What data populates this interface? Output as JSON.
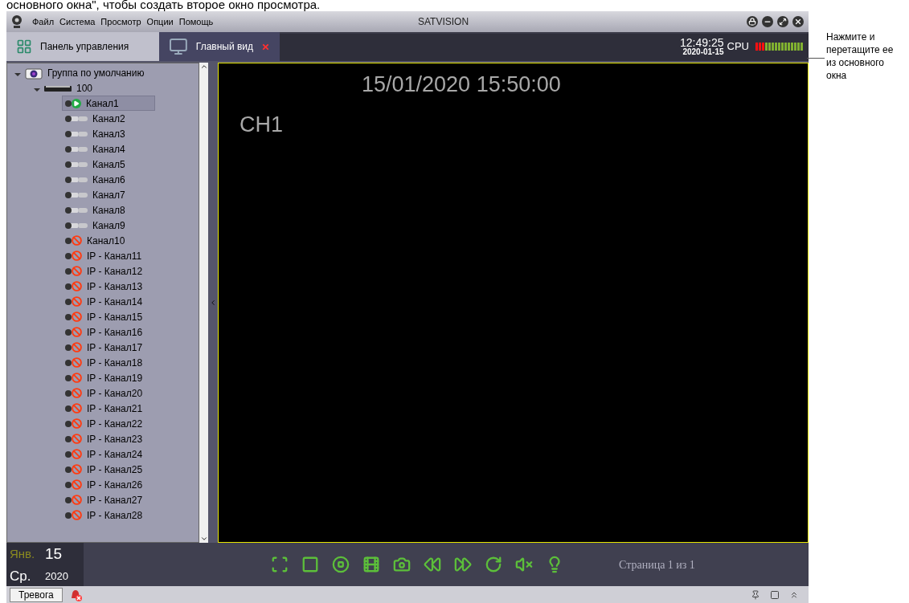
{
  "caption_top": "основного окна\", чтобы создать второе окно просмотра.",
  "window": {
    "title": "SATVISION",
    "menu": [
      "Файл",
      "Система",
      "Просмотр",
      "Опции",
      "Помощь"
    ]
  },
  "tabs": [
    {
      "label": "Панель управления",
      "selected": false,
      "closable": false
    },
    {
      "label": "Главный вид",
      "selected": true,
      "closable": true
    }
  ],
  "clock": {
    "time": "12:49:25",
    "date": "2020-01-15",
    "cpu_label": "CPU",
    "cpu": {
      "level": 0.2
    }
  },
  "tree": [
    {
      "label": "Группа по умолчанию",
      "kind": "group",
      "expanded": true,
      "children": [
        {
          "label": "100",
          "kind": "device",
          "expanded": true,
          "children": [
            {
              "label": "Канал1",
              "kind": "channel",
              "online": true,
              "playing": true,
              "selected": true
            },
            {
              "label": "Канал2",
              "kind": "channel",
              "online": true,
              "playing": false,
              "selected": false
            },
            {
              "label": "Канал3",
              "kind": "channel",
              "online": true,
              "playing": false,
              "selected": false
            },
            {
              "label": "Канал4",
              "kind": "channel",
              "online": true,
              "playing": false,
              "selected": false
            },
            {
              "label": "Канал5",
              "kind": "channel",
              "online": true,
              "playing": false,
              "selected": false
            },
            {
              "label": "Канал6",
              "kind": "channel",
              "online": true,
              "playing": false,
              "selected": false
            },
            {
              "label": "Канал7",
              "kind": "channel",
              "online": true,
              "playing": false,
              "selected": false
            },
            {
              "label": "Канал8",
              "kind": "channel",
              "online": true,
              "playing": false,
              "selected": false
            },
            {
              "label": "Канал9",
              "kind": "channel",
              "online": true,
              "playing": false,
              "selected": false
            },
            {
              "label": "Канал10",
              "kind": "channel",
              "online": false,
              "selected": false
            },
            {
              "label": "IP - Канал11",
              "kind": "channel",
              "online": false,
              "selected": false
            },
            {
              "label": "IP - Канал12",
              "kind": "channel",
              "online": false,
              "selected": false
            },
            {
              "label": "IP - Канал13",
              "kind": "channel",
              "online": false,
              "selected": false
            },
            {
              "label": "IP - Канал14",
              "kind": "channel",
              "online": false,
              "selected": false
            },
            {
              "label": "IP - Канал15",
              "kind": "channel",
              "online": false,
              "selected": false
            },
            {
              "label": "IP - Канал16",
              "kind": "channel",
              "online": false,
              "selected": false
            },
            {
              "label": "IP - Канал17",
              "kind": "channel",
              "online": false,
              "selected": false
            },
            {
              "label": "IP - Канал18",
              "kind": "channel",
              "online": false,
              "selected": false
            },
            {
              "label": "IP - Канал19",
              "kind": "channel",
              "online": false,
              "selected": false
            },
            {
              "label": "IP - Канал20",
              "kind": "channel",
              "online": false,
              "selected": false
            },
            {
              "label": "IP - Канал21",
              "kind": "channel",
              "online": false,
              "selected": false
            },
            {
              "label": "IP - Канал22",
              "kind": "channel",
              "online": false,
              "selected": false
            },
            {
              "label": "IP - Канал23",
              "kind": "channel",
              "online": false,
              "selected": false
            },
            {
              "label": "IP - Канал24",
              "kind": "channel",
              "online": false,
              "selected": false
            },
            {
              "label": "IP - Канал25",
              "kind": "channel",
              "online": false,
              "selected": false
            },
            {
              "label": "IP - Канал26",
              "kind": "channel",
              "online": false,
              "selected": false
            },
            {
              "label": "IP - Канал27",
              "kind": "channel",
              "online": false,
              "selected": false
            },
            {
              "label": "IP - Канал28",
              "kind": "channel",
              "online": false,
              "selected": false
            }
          ]
        }
      ]
    }
  ],
  "video": {
    "timestamp": "15/01/2020 15:50:00",
    "channel": "CH1"
  },
  "date_block": {
    "month": "Янв.",
    "day": "15",
    "weekday": "Ср.",
    "year": "2020"
  },
  "controls": [
    {
      "kind": "fullscreen"
    },
    {
      "kind": "single"
    },
    {
      "kind": "stop"
    },
    {
      "kind": "record"
    },
    {
      "kind": "snapshot"
    },
    {
      "kind": "rewind"
    },
    {
      "kind": "forward"
    },
    {
      "kind": "refresh"
    },
    {
      "kind": "mute"
    },
    {
      "kind": "light"
    }
  ],
  "page_info": "Страница 1 из 1",
  "status_bar": {
    "alarm_button": "Тревога"
  },
  "annotation": "Нажмите и перетащите ее из основного окна"
}
